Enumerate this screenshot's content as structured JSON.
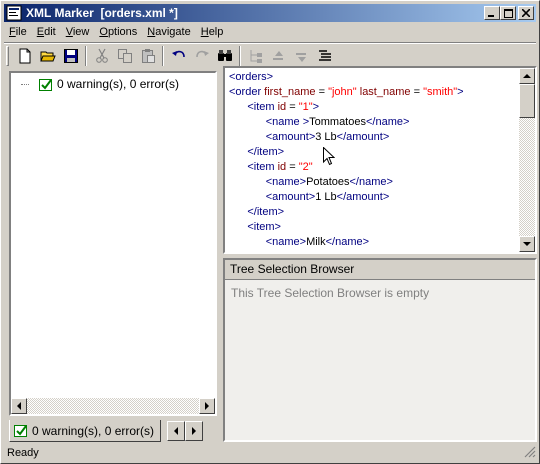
{
  "window": {
    "title": "XML Marker  [orders.xml *]"
  },
  "menu": [
    {
      "mnemonic": "F",
      "rest": "ile"
    },
    {
      "mnemonic": "E",
      "rest": "dit"
    },
    {
      "mnemonic": "V",
      "rest": "iew"
    },
    {
      "mnemonic": "O",
      "rest": "ptions"
    },
    {
      "mnemonic": "N",
      "rest": "avigate"
    },
    {
      "mnemonic": "H",
      "rest": "elp"
    }
  ],
  "toolbar": {
    "icons": [
      "new-file-icon",
      "open-folder-icon",
      "save-icon",
      "cut-icon",
      "copy-icon",
      "paste-icon",
      "undo-icon",
      "redo-icon",
      "find-icon",
      "tree-indent-icon",
      "move-up-icon",
      "move-down-icon",
      "list-icon"
    ]
  },
  "tree": {
    "root_label": "0 warning(s), 0 error(s)"
  },
  "tab": {
    "label": "0 warning(s), 0 error(s)"
  },
  "editor": {
    "lines": [
      [
        {
          "c": "tag",
          "t": "<orders>"
        }
      ],
      [
        {
          "c": "tag",
          "t": "<order "
        },
        {
          "c": "attr",
          "t": "first_name"
        },
        {
          "c": "txt",
          "t": " = "
        },
        {
          "c": "val",
          "t": "\"john\""
        },
        {
          "c": "txt",
          "t": " "
        },
        {
          "c": "attr",
          "t": "last_name"
        },
        {
          "c": "txt",
          "t": " = "
        },
        {
          "c": "val",
          "t": "\"smith\""
        },
        {
          "c": "tag",
          "t": ">"
        }
      ],
      [
        {
          "c": "txt",
          "t": "      "
        },
        {
          "c": "tag",
          "t": "<item "
        },
        {
          "c": "attr",
          "t": "id"
        },
        {
          "c": "txt",
          "t": " = "
        },
        {
          "c": "val",
          "t": "\"1\""
        },
        {
          "c": "tag",
          "t": ">"
        }
      ],
      [
        {
          "c": "txt",
          "t": "            "
        },
        {
          "c": "tag",
          "t": "<name "
        },
        {
          "c": "tag",
          "t": ">"
        },
        {
          "c": "txt",
          "t": "Tommatoes"
        },
        {
          "c": "tag",
          "t": "</name>"
        }
      ],
      [
        {
          "c": "txt",
          "t": "            "
        },
        {
          "c": "tag",
          "t": "<amount"
        },
        {
          "c": "tag",
          "t": ">"
        },
        {
          "c": "txt",
          "t": "3 Lb"
        },
        {
          "c": "tag",
          "t": "</amount>"
        }
      ],
      [
        {
          "c": "txt",
          "t": "      "
        },
        {
          "c": "tag",
          "t": "</item>"
        }
      ],
      [
        {
          "c": "txt",
          "t": "      "
        },
        {
          "c": "tag",
          "t": "<item "
        },
        {
          "c": "attr",
          "t": "id"
        },
        {
          "c": "txt",
          "t": " = "
        },
        {
          "c": "val",
          "t": "\"2\""
        }
      ],
      [
        {
          "c": "txt",
          "t": "            "
        },
        {
          "c": "tag",
          "t": "<name>"
        },
        {
          "c": "txt",
          "t": "Potatoes"
        },
        {
          "c": "tag",
          "t": "</name>"
        }
      ],
      [
        {
          "c": "txt",
          "t": "            "
        },
        {
          "c": "tag",
          "t": "<amount>"
        },
        {
          "c": "txt",
          "t": "1 Lb"
        },
        {
          "c": "tag",
          "t": "</amount>"
        }
      ],
      [
        {
          "c": "txt",
          "t": "      "
        },
        {
          "c": "tag",
          "t": "</item>"
        }
      ],
      [
        {
          "c": "txt",
          "t": "      "
        },
        {
          "c": "tag",
          "t": "<item>"
        }
      ],
      [
        {
          "c": "txt",
          "t": "            "
        },
        {
          "c": "tag",
          "t": "<name>"
        },
        {
          "c": "txt",
          "t": "Milk"
        },
        {
          "c": "tag",
          "t": "</name>"
        }
      ]
    ]
  },
  "tree_browser": {
    "title": "Tree Selection Browser",
    "empty_text": "This Tree Selection Browser is empty"
  },
  "status": {
    "text": "Ready"
  }
}
